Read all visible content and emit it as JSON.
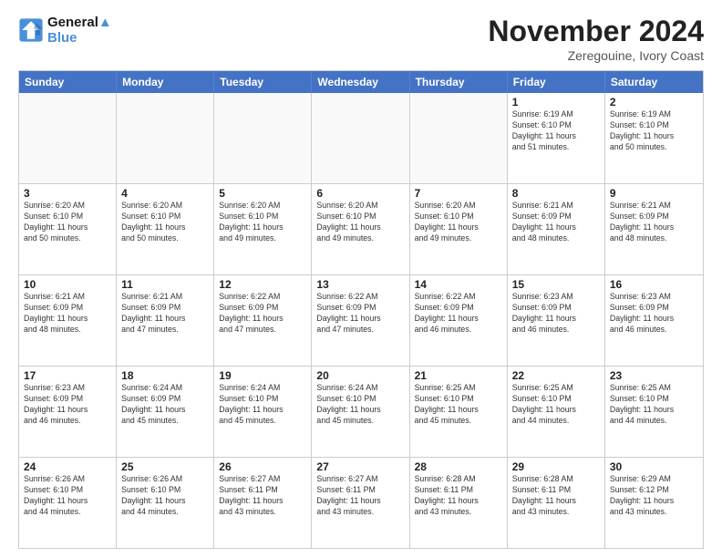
{
  "header": {
    "logo_line1": "General",
    "logo_line2": "Blue",
    "month_title": "November 2024",
    "location": "Zeregouine, Ivory Coast"
  },
  "weekdays": [
    "Sunday",
    "Monday",
    "Tuesday",
    "Wednesday",
    "Thursday",
    "Friday",
    "Saturday"
  ],
  "rows": [
    [
      {
        "day": "",
        "info": "",
        "empty": true
      },
      {
        "day": "",
        "info": "",
        "empty": true
      },
      {
        "day": "",
        "info": "",
        "empty": true
      },
      {
        "day": "",
        "info": "",
        "empty": true
      },
      {
        "day": "",
        "info": "",
        "empty": true
      },
      {
        "day": "1",
        "info": "Sunrise: 6:19 AM\nSunset: 6:10 PM\nDaylight: 11 hours\nand 51 minutes.",
        "empty": false
      },
      {
        "day": "2",
        "info": "Sunrise: 6:19 AM\nSunset: 6:10 PM\nDaylight: 11 hours\nand 50 minutes.",
        "empty": false
      }
    ],
    [
      {
        "day": "3",
        "info": "Sunrise: 6:20 AM\nSunset: 6:10 PM\nDaylight: 11 hours\nand 50 minutes.",
        "empty": false
      },
      {
        "day": "4",
        "info": "Sunrise: 6:20 AM\nSunset: 6:10 PM\nDaylight: 11 hours\nand 50 minutes.",
        "empty": false
      },
      {
        "day": "5",
        "info": "Sunrise: 6:20 AM\nSunset: 6:10 PM\nDaylight: 11 hours\nand 49 minutes.",
        "empty": false
      },
      {
        "day": "6",
        "info": "Sunrise: 6:20 AM\nSunset: 6:10 PM\nDaylight: 11 hours\nand 49 minutes.",
        "empty": false
      },
      {
        "day": "7",
        "info": "Sunrise: 6:20 AM\nSunset: 6:10 PM\nDaylight: 11 hours\nand 49 minutes.",
        "empty": false
      },
      {
        "day": "8",
        "info": "Sunrise: 6:21 AM\nSunset: 6:09 PM\nDaylight: 11 hours\nand 48 minutes.",
        "empty": false
      },
      {
        "day": "9",
        "info": "Sunrise: 6:21 AM\nSunset: 6:09 PM\nDaylight: 11 hours\nand 48 minutes.",
        "empty": false
      }
    ],
    [
      {
        "day": "10",
        "info": "Sunrise: 6:21 AM\nSunset: 6:09 PM\nDaylight: 11 hours\nand 48 minutes.",
        "empty": false
      },
      {
        "day": "11",
        "info": "Sunrise: 6:21 AM\nSunset: 6:09 PM\nDaylight: 11 hours\nand 47 minutes.",
        "empty": false
      },
      {
        "day": "12",
        "info": "Sunrise: 6:22 AM\nSunset: 6:09 PM\nDaylight: 11 hours\nand 47 minutes.",
        "empty": false
      },
      {
        "day": "13",
        "info": "Sunrise: 6:22 AM\nSunset: 6:09 PM\nDaylight: 11 hours\nand 47 minutes.",
        "empty": false
      },
      {
        "day": "14",
        "info": "Sunrise: 6:22 AM\nSunset: 6:09 PM\nDaylight: 11 hours\nand 46 minutes.",
        "empty": false
      },
      {
        "day": "15",
        "info": "Sunrise: 6:23 AM\nSunset: 6:09 PM\nDaylight: 11 hours\nand 46 minutes.",
        "empty": false
      },
      {
        "day": "16",
        "info": "Sunrise: 6:23 AM\nSunset: 6:09 PM\nDaylight: 11 hours\nand 46 minutes.",
        "empty": false
      }
    ],
    [
      {
        "day": "17",
        "info": "Sunrise: 6:23 AM\nSunset: 6:09 PM\nDaylight: 11 hours\nand 46 minutes.",
        "empty": false
      },
      {
        "day": "18",
        "info": "Sunrise: 6:24 AM\nSunset: 6:09 PM\nDaylight: 11 hours\nand 45 minutes.",
        "empty": false
      },
      {
        "day": "19",
        "info": "Sunrise: 6:24 AM\nSunset: 6:10 PM\nDaylight: 11 hours\nand 45 minutes.",
        "empty": false
      },
      {
        "day": "20",
        "info": "Sunrise: 6:24 AM\nSunset: 6:10 PM\nDaylight: 11 hours\nand 45 minutes.",
        "empty": false
      },
      {
        "day": "21",
        "info": "Sunrise: 6:25 AM\nSunset: 6:10 PM\nDaylight: 11 hours\nand 45 minutes.",
        "empty": false
      },
      {
        "day": "22",
        "info": "Sunrise: 6:25 AM\nSunset: 6:10 PM\nDaylight: 11 hours\nand 44 minutes.",
        "empty": false
      },
      {
        "day": "23",
        "info": "Sunrise: 6:25 AM\nSunset: 6:10 PM\nDaylight: 11 hours\nand 44 minutes.",
        "empty": false
      }
    ],
    [
      {
        "day": "24",
        "info": "Sunrise: 6:26 AM\nSunset: 6:10 PM\nDaylight: 11 hours\nand 44 minutes.",
        "empty": false
      },
      {
        "day": "25",
        "info": "Sunrise: 6:26 AM\nSunset: 6:10 PM\nDaylight: 11 hours\nand 44 minutes.",
        "empty": false
      },
      {
        "day": "26",
        "info": "Sunrise: 6:27 AM\nSunset: 6:11 PM\nDaylight: 11 hours\nand 43 minutes.",
        "empty": false
      },
      {
        "day": "27",
        "info": "Sunrise: 6:27 AM\nSunset: 6:11 PM\nDaylight: 11 hours\nand 43 minutes.",
        "empty": false
      },
      {
        "day": "28",
        "info": "Sunrise: 6:28 AM\nSunset: 6:11 PM\nDaylight: 11 hours\nand 43 minutes.",
        "empty": false
      },
      {
        "day": "29",
        "info": "Sunrise: 6:28 AM\nSunset: 6:11 PM\nDaylight: 11 hours\nand 43 minutes.",
        "empty": false
      },
      {
        "day": "30",
        "info": "Sunrise: 6:29 AM\nSunset: 6:12 PM\nDaylight: 11 hours\nand 43 minutes.",
        "empty": false
      }
    ]
  ]
}
